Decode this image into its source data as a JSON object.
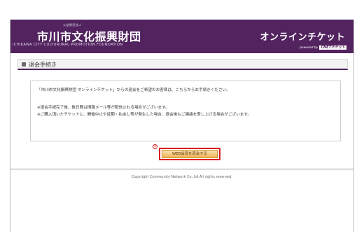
{
  "header": {
    "org_small": "公益財団法人",
    "org_name": "市川市文化振興財団",
    "org_english": "ICHIKAWA CITY CULTURURAL PROMOTION FOUNDATION",
    "online_title": "オンラインチケット",
    "powered_by": "powered by",
    "powered_brand": "CNETチケット"
  },
  "section": {
    "title": "退会手続き",
    "icon": "square-bullet-icon"
  },
  "notice": {
    "line1": "「市川市文化振興財団 オンラインチケット」からの退会をご希望のお客様は、こちらからお手続きください。",
    "line2": "※退会手続完了後、数日間は情報メール等が配信される場合がございます。",
    "line3": "※ご購入頂いたチケットに、開催中止や延期・払戻し等が発生した場合、退会後もご連絡を差し上げる場合がございます。"
  },
  "action": {
    "step_marker": "②",
    "button_label": "WEB会員を退会する"
  },
  "footer": {
    "copyright": "Copyright Community Network Co.,ltd All rights reserved."
  },
  "colors": {
    "header_bg": "#52235f",
    "highlight_border": "#d81e1e",
    "button_fill": "#f0b556"
  }
}
